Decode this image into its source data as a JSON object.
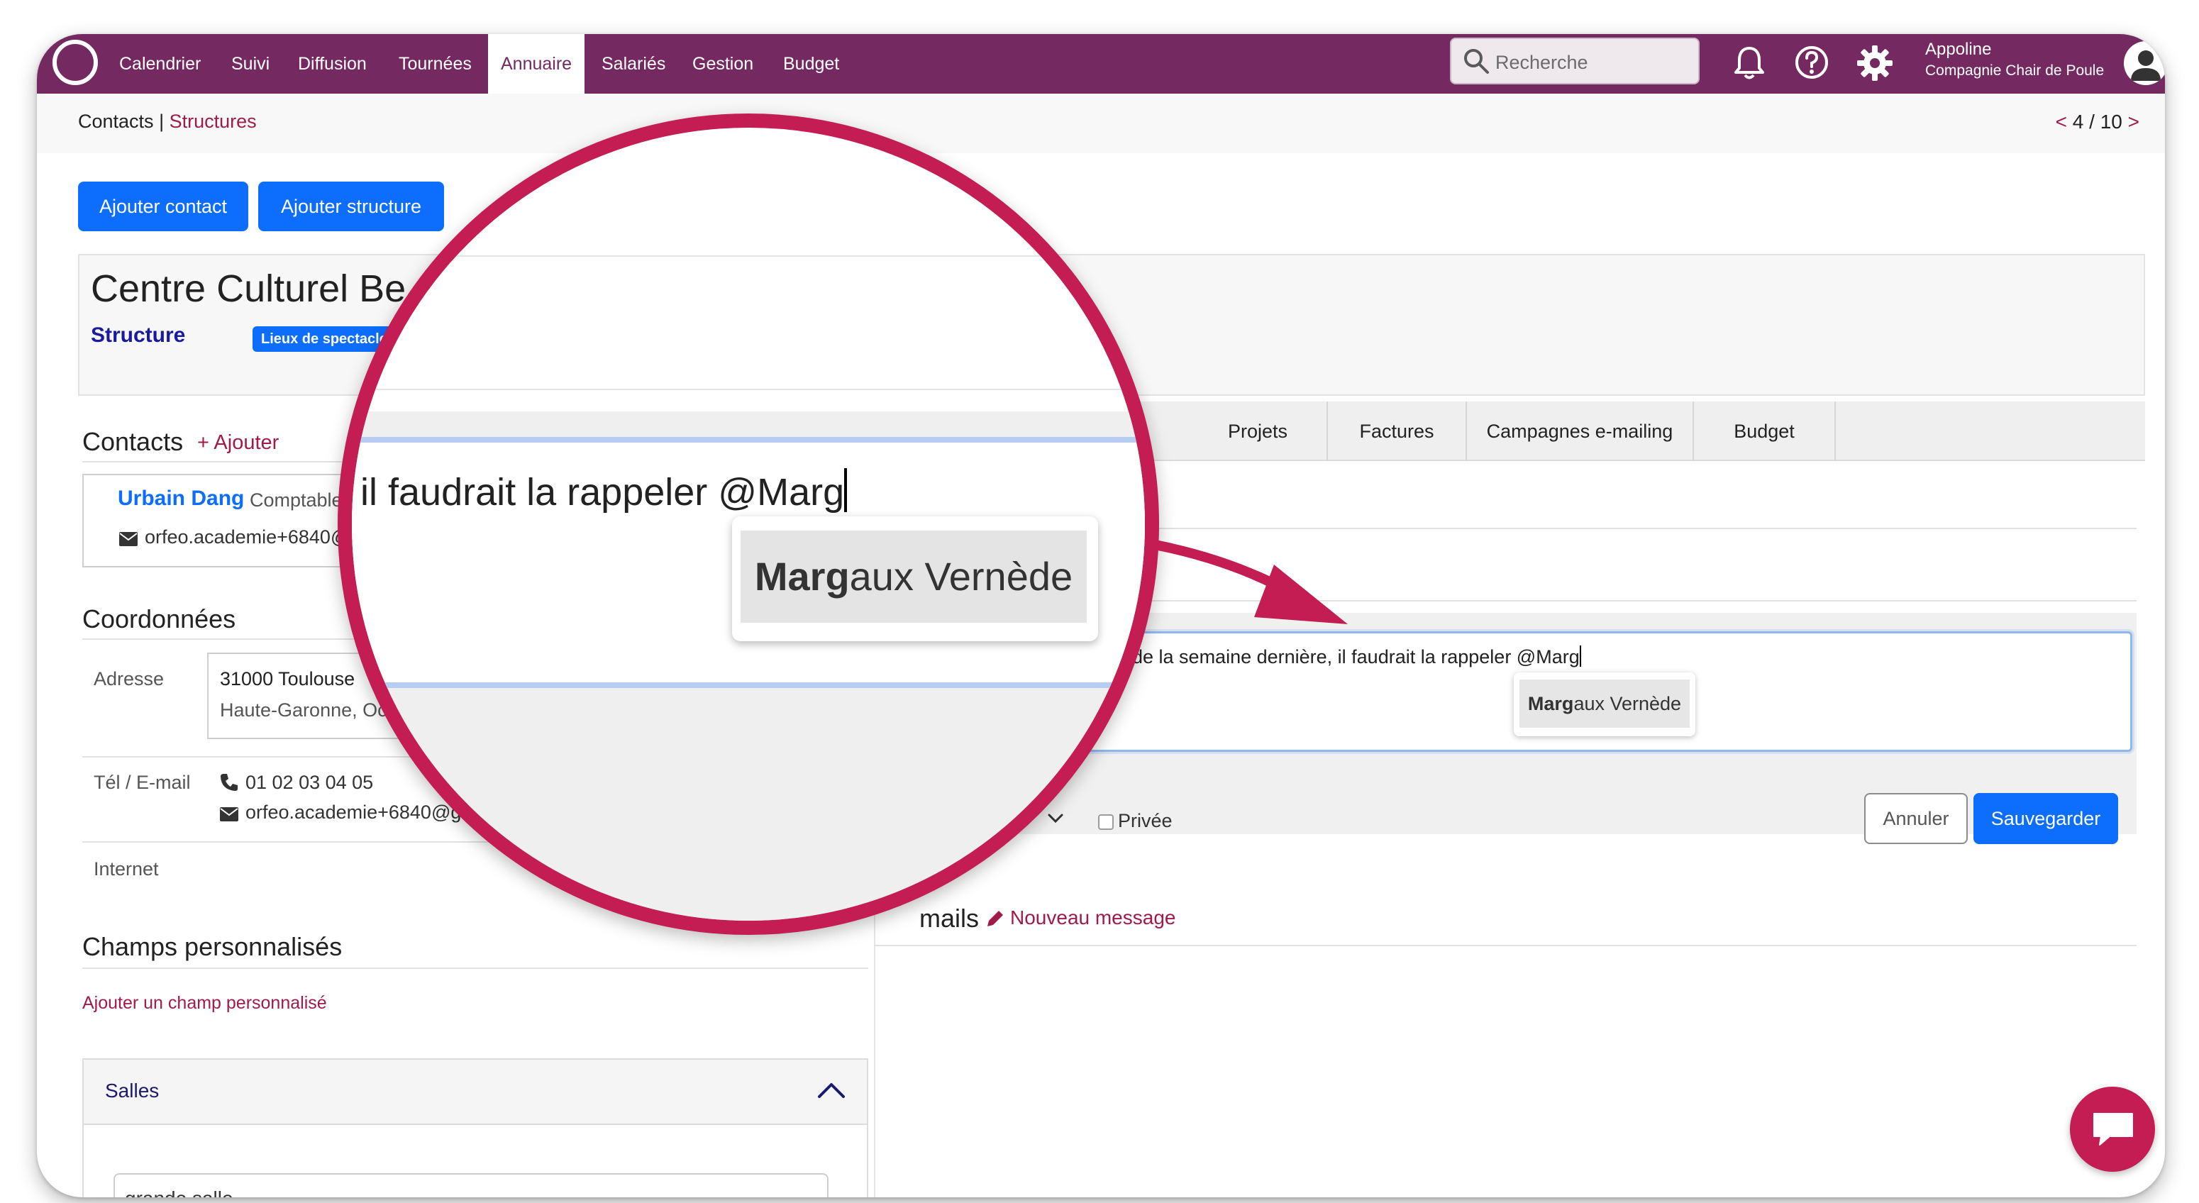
{
  "nav": {
    "items": [
      "Calendrier",
      "Suivi",
      "Diffusion",
      "Tournées",
      "Annuaire",
      "Salariés",
      "Gestion",
      "Budget"
    ],
    "active": "Annuaire"
  },
  "search": {
    "placeholder": "Recherche"
  },
  "user": {
    "name": "Appoline",
    "company": "Compagnie Chair de Poule"
  },
  "breadcrumb": {
    "contacts": "Contacts",
    "sep": " | ",
    "structures": "Structures"
  },
  "pager": {
    "prev": "<",
    "text": "4 / 10",
    "next": ">"
  },
  "actions": {
    "add_contact": "Ajouter contact",
    "add_structure": "Ajouter structure"
  },
  "structure": {
    "name": "Centre Culturel Be",
    "type": "Structure",
    "badge": "Lieux de spectacle"
  },
  "contacts": {
    "title": "Contacts",
    "add": "Ajouter",
    "person_name": "Urbain Dang",
    "person_role": "Comptable",
    "person_email": "orfeo.academie+6840@"
  },
  "coords": {
    "title": "Coordonnées",
    "address_label": "Adresse",
    "address_line1": "31000 Toulouse",
    "address_line2": "Haute-Garonne, Oc",
    "phone_label": "Tél / E-mail",
    "phone": "01 02 03 04 05",
    "email": "orfeo.academie+6840@gr",
    "internet_label": "Internet"
  },
  "custom_fields": {
    "title": "Champs personnalisés",
    "add": "Ajouter un champ personnalisé"
  },
  "salles": {
    "title": "Salles",
    "first": "grande salle"
  },
  "tabs": [
    "Projets",
    "Factures",
    "Campagnes e-mailing",
    "Budget"
  ],
  "note": {
    "text": "de la semaine dernière, il faudrait la rappeler @Marg",
    "mention_bold": "Marg",
    "mention_rest": "aux Vernède",
    "private": "Privée",
    "cancel": "Annuler",
    "save": "Sauvegarder"
  },
  "mails": {
    "title": "mails",
    "new": "Nouveau message"
  },
  "zoom": {
    "text": "il faudrait la rappeler @Marg",
    "mention_bold": "Marg",
    "mention_rest": "aux Vernède"
  },
  "colors": {
    "brand": "#742a61",
    "accent": "#c31d53",
    "primary": "#0d6efd",
    "link": "#a01b4b"
  }
}
